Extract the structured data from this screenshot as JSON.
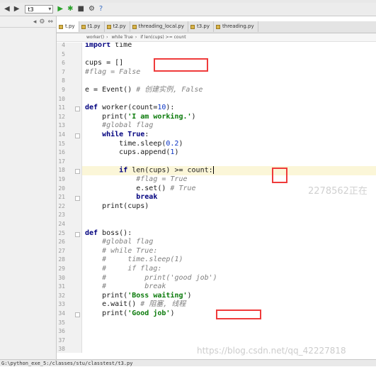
{
  "toolbar": {
    "run_config": "t3",
    "icons": [
      "back-arrow-icon",
      "forward-arrow-icon",
      "run-icon",
      "debug-icon",
      "stop-icon",
      "settings-icon",
      "help-icon"
    ],
    "help_label": "?"
  },
  "tabs": [
    {
      "label": "t.py",
      "active": true
    },
    {
      "label": "t1.py",
      "active": false
    },
    {
      "label": "t2.py",
      "active": false
    },
    {
      "label": "threading_local.py",
      "active": false
    },
    {
      "label": "t3.py",
      "active": false
    },
    {
      "label": "threading.py",
      "active": false
    }
  ],
  "breadcrumb": [
    "worker()",
    "while True",
    "if len(cups) >= count"
  ],
  "code_lines": [
    {
      "n": "4",
      "text": "import time"
    },
    {
      "n": "5",
      "text": ""
    },
    {
      "n": "6",
      "text": "cups = []"
    },
    {
      "n": "7",
      "text": "#flag = False"
    },
    {
      "n": "8",
      "text": ""
    },
    {
      "n": "9",
      "text": "e = Event() # 创建实例, False"
    },
    {
      "n": "10",
      "text": ""
    },
    {
      "n": "11",
      "text": "def worker(count=10):"
    },
    {
      "n": "12",
      "text": "    print('I am working.')"
    },
    {
      "n": "13",
      "text": "    #global flag"
    },
    {
      "n": "14",
      "text": "    while True:"
    },
    {
      "n": "15",
      "text": "        time.sleep(0.2)"
    },
    {
      "n": "16",
      "text": "        cups.append(1)"
    },
    {
      "n": "17",
      "text": ""
    },
    {
      "n": "18",
      "text": "        if len(cups) >= count:"
    },
    {
      "n": "19",
      "text": "            #flag = True"
    },
    {
      "n": "20",
      "text": "            e.set() # True"
    },
    {
      "n": "21",
      "text": "            break"
    },
    {
      "n": "22",
      "text": "    print(cups)"
    },
    {
      "n": "23",
      "text": ""
    },
    {
      "n": "24",
      "text": ""
    },
    {
      "n": "25",
      "text": "def boss():"
    },
    {
      "n": "26",
      "text": "    #global flag"
    },
    {
      "n": "27",
      "text": "    # while True:"
    },
    {
      "n": "28",
      "text": "    #     time.sleep(1)"
    },
    {
      "n": "29",
      "text": "    #     if flag:"
    },
    {
      "n": "30",
      "text": "    #         print('good job')"
    },
    {
      "n": "31",
      "text": "    #         break"
    },
    {
      "n": "32",
      "text": "    print('Boss waiting')"
    },
    {
      "n": "33",
      "text": "    e.wait() # 阻塞, 线程"
    },
    {
      "n": "34",
      "text": "    print('Good job')"
    },
    {
      "n": "35",
      "text": ""
    },
    {
      "n": "36",
      "text": ""
    },
    {
      "n": "37",
      "text": ""
    },
    {
      "n": "38",
      "text": ""
    }
  ],
  "watermarks": {
    "side": "2278562正在",
    "bottom": "https://blog.csdn.net/qq_42227818"
  },
  "status": {
    "text": "G:\\python_exe_5:/classes/stu/classtest/t3.py"
  },
  "colors": {
    "keyword": "#00007f",
    "string": "#0a7a0a",
    "comment": "#808080",
    "number": "#0a33c4",
    "annotation_box": "#ef3b3b",
    "current_line": "#fbf6d8"
  }
}
